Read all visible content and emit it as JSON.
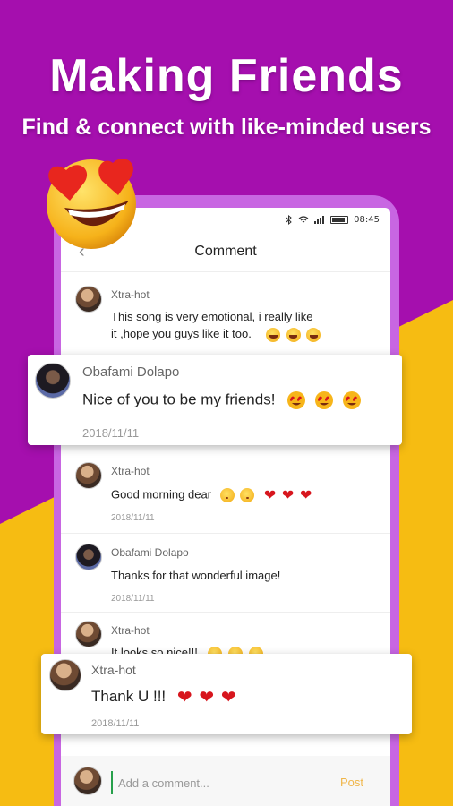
{
  "headline": {
    "title": "Making Friends",
    "subtitle": "Find & connect with like-minded users"
  },
  "statusbar": {
    "time": "08:45"
  },
  "appbar": {
    "title": "Comment"
  },
  "comments": [
    {
      "user": "Xtra-hot",
      "text": "This song is very emotional, i really like",
      "text2": "it ,hope you guys like it too."
    },
    {
      "user": "Obafami Dolapo",
      "text": "Nice of you to be my friends!",
      "date": "2018/11/11"
    },
    {
      "user": "Xtra-hot",
      "text": "Good morning dear",
      "date": "2018/11/11"
    },
    {
      "user": "Obafami Dolapo",
      "text": "Thanks for that wonderful image!",
      "date": "2018/11/11"
    },
    {
      "user": "Xtra-hot",
      "text": "It looks so nice!!!"
    },
    {
      "user": "Xtra-hot",
      "text": "Thank U !!!",
      "date": "2018/11/11"
    }
  ],
  "input": {
    "placeholder": "Add a comment...",
    "post_label": "Post"
  },
  "icons": {
    "bluetooth": "bluetooth-icon",
    "wifi": "wifi-icon",
    "signal": "signal-icon",
    "battery": "battery-icon",
    "back": "back-arrow-icon",
    "heart": "heart-icon",
    "laugh": "laughing-emoji-icon",
    "kiss": "kissing-emoji-icon",
    "heart_eyes": "heart-eyes-emoji-icon"
  },
  "colors": {
    "background_purple": "#a50fae",
    "background_yellow": "#f6bc12",
    "phone_frame": "#c866e2",
    "post_accent": "#f0b64a",
    "input_cursor": "#27a04b",
    "heart": "#d7161e"
  }
}
